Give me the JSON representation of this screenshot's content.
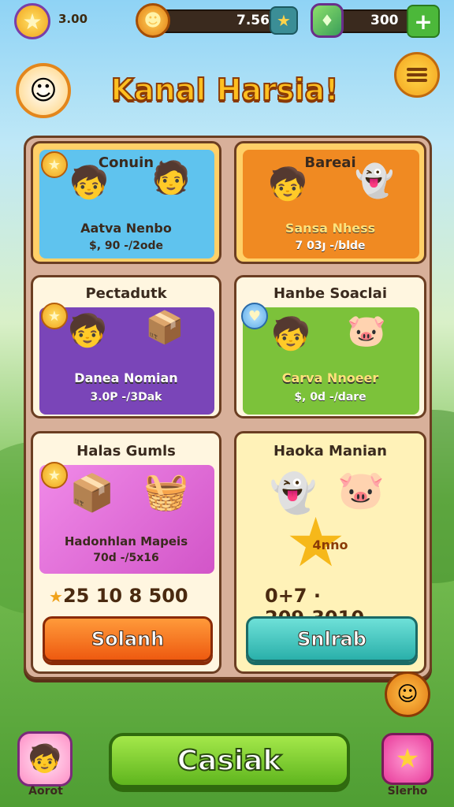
{
  "topbar": {
    "star_count": "3.00",
    "coin_value": "7.56",
    "gem_value": "300",
    "plus_symbol": "+"
  },
  "header": {
    "title": "Kanal Harsia!"
  },
  "cards": [
    {
      "heading": "Conuin",
      "panel_title": "Aatva Nenbo",
      "panel_sub": "$, 90 -/2ode",
      "color": "#5fc3ee"
    },
    {
      "heading": "Bareai",
      "panel_title": "Sansa Nhess",
      "panel_sub": "7 03ȷ -/blde",
      "color": "#f08a22"
    },
    {
      "heading": "Pectadutk",
      "panel_title": "Danea Nomian",
      "panel_sub": "3.0P -/3Dak",
      "color": "#7a45b8"
    },
    {
      "heading": "Hanbe Soaclai",
      "panel_title": "Carva Nnoeer",
      "panel_sub": "$, 0d -/dare",
      "color": "#7cc23a"
    },
    {
      "heading": "Halas Gumls",
      "panel_title": "Hadonhlan Mapeis",
      "panel_sub": "70d -/5x16",
      "color": "#e36ad6"
    },
    {
      "heading": "Haoka Manian",
      "panel_title": "4nno",
      "panel_sub": "",
      "color": "#fff2b8"
    }
  ],
  "prices": {
    "left": "25 10 8 500",
    "right": "0+7 · 209.3010"
  },
  "buttons": {
    "left_cta": "Solanh",
    "right_cta": "Snlrab",
    "main": "Casiak"
  },
  "bottom": {
    "left_label": "Aorot",
    "right_label": "Slerho"
  },
  "icons": {
    "star": "★",
    "coin": "☻",
    "gem": "♦",
    "menu": "menu-icon"
  },
  "colors": {
    "accent_orange": "#f0a21a",
    "accent_green": "#5fb51e",
    "board": "#d8b09a"
  }
}
